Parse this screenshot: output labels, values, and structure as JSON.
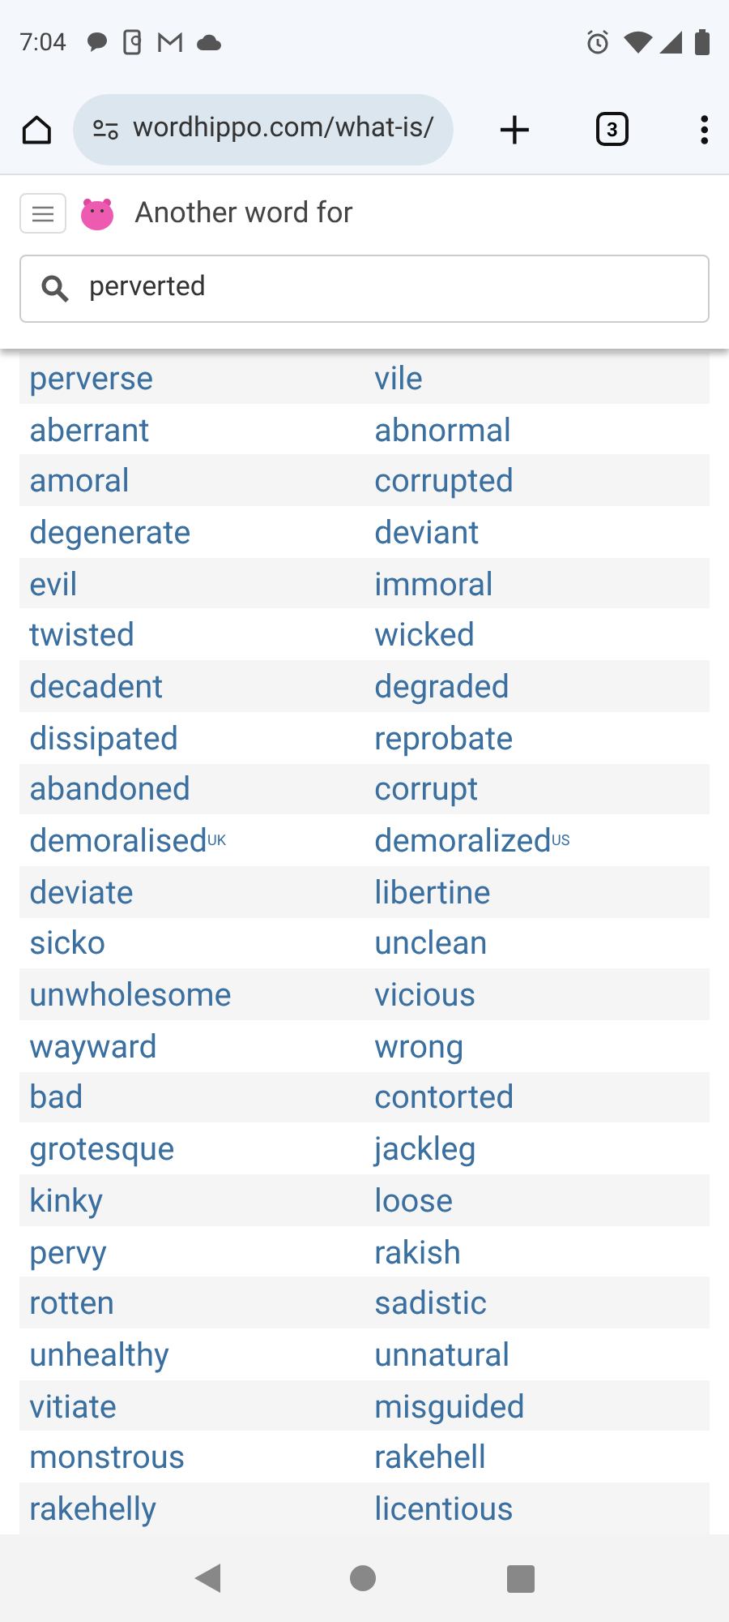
{
  "status_bar": {
    "time": "7:04"
  },
  "browser": {
    "url": "wordhippo.com/what-is/",
    "tab_count": "3"
  },
  "header": {
    "title": "Another word for",
    "search": {
      "value": "perverted"
    }
  },
  "synonyms": [
    [
      "perverse",
      "vile"
    ],
    [
      "aberrant",
      "abnormal"
    ],
    [
      "amoral",
      "corrupted"
    ],
    [
      "degenerate",
      "deviant"
    ],
    [
      "evil",
      "immoral"
    ],
    [
      "twisted",
      "wicked"
    ],
    [
      "decadent",
      "degraded"
    ],
    [
      "dissipated",
      "reprobate"
    ],
    [
      "abandoned",
      "corrupt"
    ],
    [
      "demoralised$^{UK}$",
      "demoralized$^{US}$"
    ],
    [
      "deviate",
      "libertine"
    ],
    [
      "sicko",
      "unclean"
    ],
    [
      "unwholesome",
      "vicious"
    ],
    [
      "wayward",
      "wrong"
    ],
    [
      "bad",
      "contorted"
    ],
    [
      "grotesque",
      "jackleg"
    ],
    [
      "kinky",
      "loose"
    ],
    [
      "pervy",
      "rakish"
    ],
    [
      "rotten",
      "sadistic"
    ],
    [
      "unhealthy",
      "unnatural"
    ],
    [
      "vitiate",
      "misguided"
    ],
    [
      "monstrous",
      "rakehell"
    ],
    [
      "rakehelly",
      "licentious"
    ]
  ]
}
